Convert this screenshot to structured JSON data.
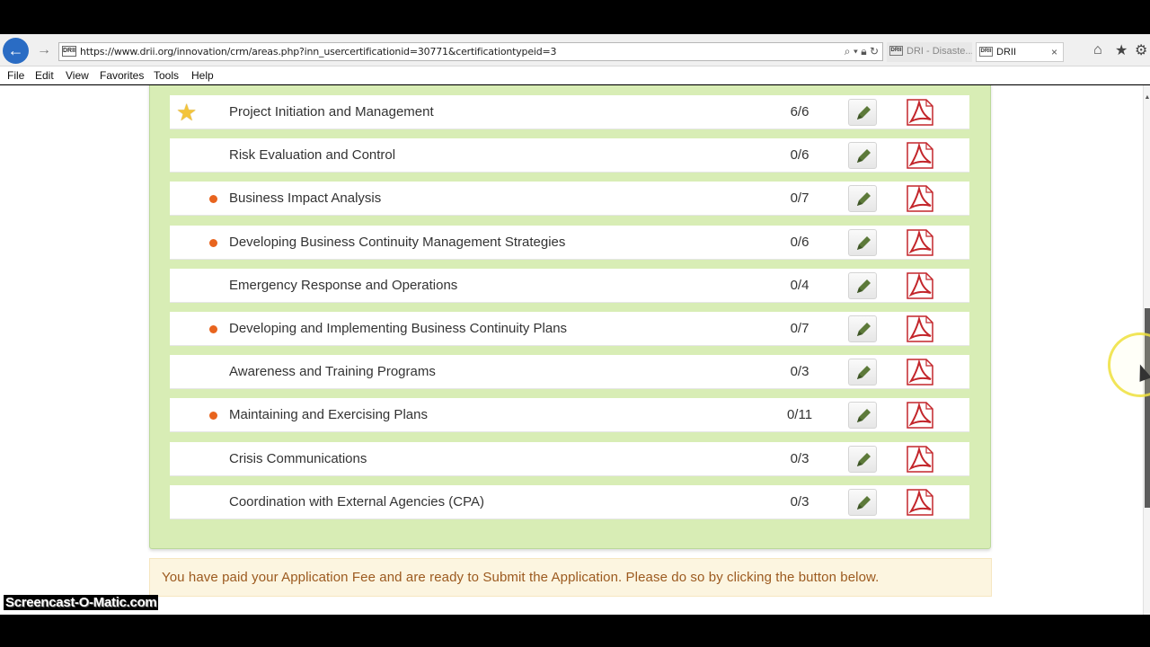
{
  "browser": {
    "url": "https://www.drii.org/innovation/crm/areas.php?inn_usercertificationid=30771&certificationtypeid=3",
    "tabs": [
      {
        "label": "DRI - Disaste..."
      },
      {
        "label": "DRII",
        "close": "×"
      }
    ],
    "favicon_text": "DRII",
    "menu": [
      "File",
      "Edit",
      "View",
      "Favorites",
      "Tools",
      "Help"
    ]
  },
  "areas": [
    {
      "name": "Project Initiation and Management",
      "score": "6/6",
      "marker": "star"
    },
    {
      "name": "Risk Evaluation and Control",
      "score": "0/6",
      "marker": "none"
    },
    {
      "name": "Business Impact Analysis",
      "score": "0/7",
      "marker": "dot"
    },
    {
      "name": "Developing Business Continuity Management Strategies",
      "score": "0/6",
      "marker": "dot"
    },
    {
      "name": "Emergency Response and Operations",
      "score": "0/4",
      "marker": "none"
    },
    {
      "name": "Developing and Implementing Business Continuity Plans",
      "score": "0/7",
      "marker": "dot"
    },
    {
      "name": "Awareness and Training Programs",
      "score": "0/3",
      "marker": "none"
    },
    {
      "name": "Maintaining and Exercising Plans",
      "score": "0/11",
      "marker": "dot"
    },
    {
      "name": "Crisis Communications",
      "score": "0/3",
      "marker": "none"
    },
    {
      "name": "Coordination with External Agencies (CPA)",
      "score": "0/3",
      "marker": "none"
    }
  ],
  "notice": "You have paid your Application Fee and are ready to Submit the Application. Please do so by clicking the button below.",
  "watermark": "Screencast-O-Matic.com",
  "colors": {
    "panel": "#d8edb5",
    "dot": "#e8641e",
    "star": "#f3c43a",
    "notice_bg": "#fcf5e0",
    "notice_text": "#9c5a1f",
    "edit_icon": "#5d7a3a",
    "pdf_icon": "#c3262b"
  },
  "icons": {
    "edit": "pencil-icon",
    "pdf": "pdf-icon",
    "completed": "star-icon",
    "incomplete": "dot-icon"
  }
}
